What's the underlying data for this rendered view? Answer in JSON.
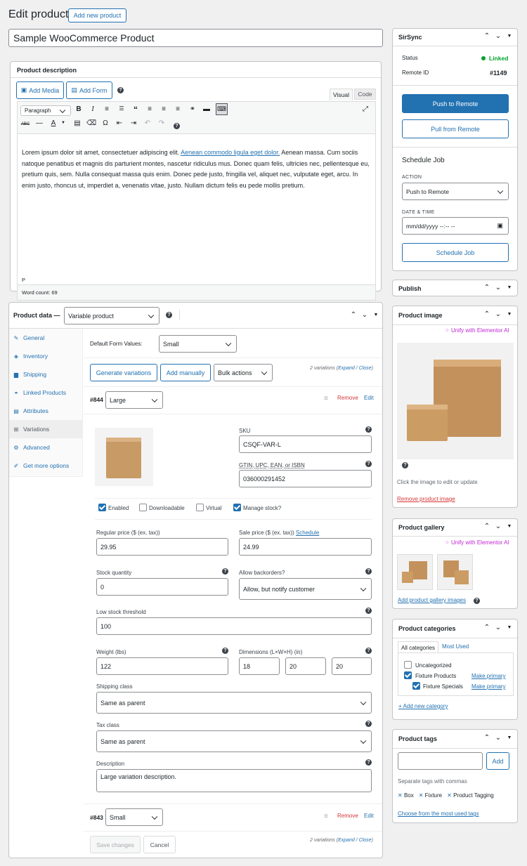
{
  "header": {
    "title": "Edit product",
    "add_new": "Add new product"
  },
  "product_title": "Sample WooCommerce Product",
  "description": {
    "heading": "Product description",
    "add_media": "Add Media",
    "add_form": "Add Form",
    "tab_visual": "Visual",
    "tab_code": "Code",
    "format": "Paragraph",
    "text_before": "Lorem ipsum dolor sit amet, consectetuer adipiscing elit. ",
    "link": "Aenean commodo ligula eget dolor.",
    "text_after": " Aenean massa. Cum sociis natoque penatibus et magnis dis parturient montes, nascetur ridiculus mus. Donec quam felis, ultricies nec, pellentesque eu, pretium quis, sem. Nulla consequat massa quis enim. Donec pede justo, fringilla vel, aliquet nec, vulputate eget, arcu. In enim justo, rhoncus ut, imperdiet a, venenatis vitae, justo. Nullam dictum felis eu pede mollis pretium.",
    "path": "P",
    "word_count": "Word count: 69"
  },
  "product_data": {
    "heading": "Product data —",
    "type": "Variable product",
    "nav": [
      "General",
      "Inventory",
      "Shipping",
      "Linked Products",
      "Attributes",
      "Variations",
      "Advanced",
      "Get more options"
    ],
    "default_form_label": "Default Form Values:",
    "default_form_value": "Small",
    "generate": "Generate variations",
    "add_manually": "Add manually",
    "bulk": "Bulk actions",
    "var_count": "2 variations (",
    "expand": "Expand",
    "sep": " / ",
    "close": "Close",
    "close_paren": ")",
    "var1": {
      "id": "#844",
      "size": "Large",
      "remove": "Remove",
      "edit": "Edit",
      "sku_label": "SKU",
      "sku": "CSQF-VAR-L",
      "gtin_label": "GTIN, UPC, EAN, or ISBN",
      "gtin": "036000291452",
      "enabled": "Enabled",
      "downloadable": "Downloadable",
      "virtual": "Virtual",
      "manage_stock": "Manage stock?",
      "regular_label": "Regular price ($ (ex. tax))",
      "regular": "29.95",
      "sale_label": "Sale price ($ (ex. tax))",
      "schedule": "Schedule",
      "sale": "24.99",
      "stock_label": "Stock quantity",
      "stock": "0",
      "backorders_label": "Allow backorders?",
      "backorders": "Allow, but notify customer",
      "low_label": "Low stock threshold",
      "low": "100",
      "weight_label": "Weight (lbs)",
      "weight": "122",
      "dims_label": "Dimensions (L×W×H) (in)",
      "dim_l": "18",
      "dim_w": "20",
      "dim_h": "20",
      "ship_label": "Shipping class",
      "ship": "Same as parent",
      "tax_label": "Tax class",
      "tax": "Same as parent",
      "desc_label": "Description",
      "desc": "Large variation description."
    },
    "var2": {
      "id": "#843",
      "size": "Small",
      "remove": "Remove",
      "edit": "Edit"
    },
    "save": "Save changes",
    "cancel": "Cancel"
  },
  "sirsync": {
    "title": "SirSync",
    "status_label": "Status",
    "status": "Linked",
    "remote_label": "Remote ID",
    "remote": "#1149",
    "push": "Push to Remote",
    "pull": "Pull from Remote",
    "schedule_title": "Schedule Job",
    "action_label": "ACTION",
    "action": "Push to Remote",
    "dt_label": "DATE & TIME",
    "dt": "mm/dd/yyyy --:-- --",
    "schedule_btn": "Schedule Job"
  },
  "publish": {
    "title": "Publish"
  },
  "product_image": {
    "title": "Product image",
    "unify": "Unify with Elementor AI",
    "hint": "Click the image to edit or update",
    "remove": "Remove product image"
  },
  "gallery": {
    "title": "Product gallery",
    "unify": "Unify with Elementor AI",
    "add": "Add product gallery images"
  },
  "categories": {
    "title": "Product categories",
    "tab_all": "All categories",
    "tab_used": "Most Used",
    "items": [
      {
        "name": "Uncategorized",
        "checked": false
      },
      {
        "name": "Fixture Products",
        "checked": true,
        "primary": "Make primary"
      },
      {
        "name": "Fixture Specials",
        "checked": true,
        "primary": "Make primary"
      }
    ],
    "add": "+ Add new category"
  },
  "tags": {
    "title": "Product tags",
    "add": "Add",
    "hint": "Separate tags with commas",
    "items": [
      "Box",
      "Fixture",
      "Product Tagging"
    ],
    "choose": "Choose from the most used tags"
  },
  "colors": {
    "accent": "#2271b1",
    "danger": "#d63638",
    "success": "#00a32a",
    "ai": "#c026d3"
  }
}
